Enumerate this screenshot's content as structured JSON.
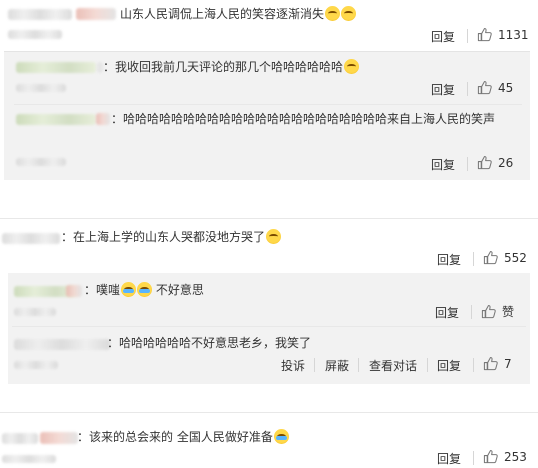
{
  "comments": [
    {
      "text": "山东人民调侃上海人民的笑容逐渐消失",
      "reply": "回复",
      "likes": "1131"
    },
    {
      "text": "我收回我前几天评论的那几个哈哈哈哈哈哈",
      "reply": "回复",
      "likes": "45"
    },
    {
      "text": "哈哈哈哈哈哈哈哈哈哈哈哈哈哈哈哈哈哈哈哈哈哈来自上海人民的笑声",
      "reply": "回复",
      "likes": "26"
    },
    {
      "text": "在上海上学的山东人哭都没地方哭了",
      "reply": "回复",
      "likes": "552"
    },
    {
      "text": "噗嗤",
      "text2": "不好意思",
      "reply": "回复",
      "likes": "赞"
    },
    {
      "text": "哈哈哈哈哈哈不好意思老乡，我笑了",
      "report": "投诉",
      "block": "屏蔽",
      "view": "查看对话",
      "reply": "回复",
      "likes": "7"
    },
    {
      "text": "该来的总会来的 全国人民做好准备",
      "reply": "回复",
      "likes": "253"
    }
  ],
  "colon": "：",
  "icons": {
    "like": "thumbs-up-icon",
    "emoji": "smile-emoji-icon",
    "cry": "laugh-cry-emoji-icon"
  }
}
